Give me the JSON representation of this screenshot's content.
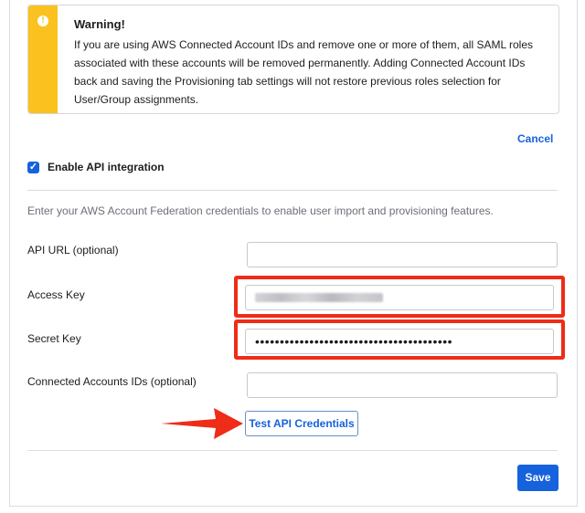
{
  "warning": {
    "title": "Warning!",
    "message": "If you are using AWS Connected Account IDs and remove one or more of them, all SAML roles associated with these accounts will be removed permanently. Adding Connected Account IDs back and saving the Provisioning tab settings will not restore previous roles selection for User/Group assignments.",
    "icon": "exclamation-icon",
    "color": "#fbc11f"
  },
  "cancel_label": "Cancel",
  "enable_api": {
    "label": "Enable API integration",
    "checked": true
  },
  "description": "Enter your AWS Account Federation credentials to enable user import and provisioning features.",
  "fields": {
    "api_url": {
      "label": "API URL (optional)",
      "value": ""
    },
    "access_key": {
      "label": "Access Key",
      "value": ""
    },
    "secret_key": {
      "label": "Secret Key",
      "value": "••••••••••••••••••••••••••••••••••••••••"
    },
    "connected_accounts": {
      "label": "Connected Accounts IDs (optional)",
      "value": ""
    }
  },
  "test_button_label": "Test API Credentials",
  "save_label": "Save",
  "colors": {
    "primary": "#1662dd",
    "highlight": "#ee2c17",
    "warning": "#fbc11f"
  }
}
